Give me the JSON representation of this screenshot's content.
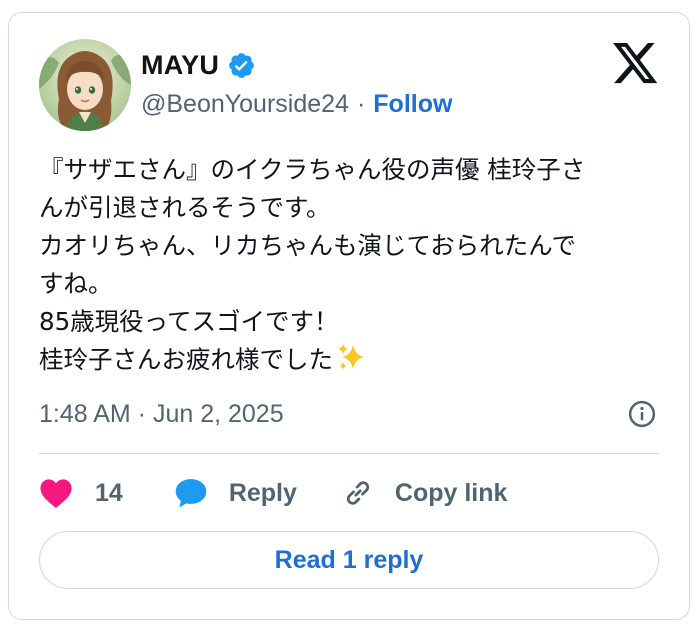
{
  "author": {
    "display_name": "MAYU",
    "handle": "@BeonYourside24",
    "separator": "·",
    "follow_label": "Follow"
  },
  "tweet": {
    "lines": [
      "『サザエさん』のイクラちゃん役の声優 桂玲子さ",
      "んが引退されるそうです。",
      "カオリちゃん、リカちゃんも演じておられたんで",
      "すね。",
      "85歳現役ってスゴイです！",
      "桂玲子さんお疲れ様でした"
    ],
    "timestamp": "1:48 AM · Jun 2, 2025"
  },
  "actions": {
    "like_count": "14",
    "reply_label": "Reply",
    "copy_link_label": "Copy link"
  },
  "read_reply_label": "Read 1 reply",
  "icons": {
    "verified": "verified-badge-icon",
    "brand": "x-logo-icon",
    "info": "info-icon",
    "like": "heart-icon",
    "reply": "speech-bubble-icon",
    "copy": "link-icon",
    "sparkles": "sparkles-emoji-icon"
  },
  "colors": {
    "accent": "#1d6fd6",
    "verified": "#1d9bf0",
    "heart": "#f91880",
    "muted": "#536471",
    "text": "#0f1419",
    "border": "#cfd9de"
  }
}
